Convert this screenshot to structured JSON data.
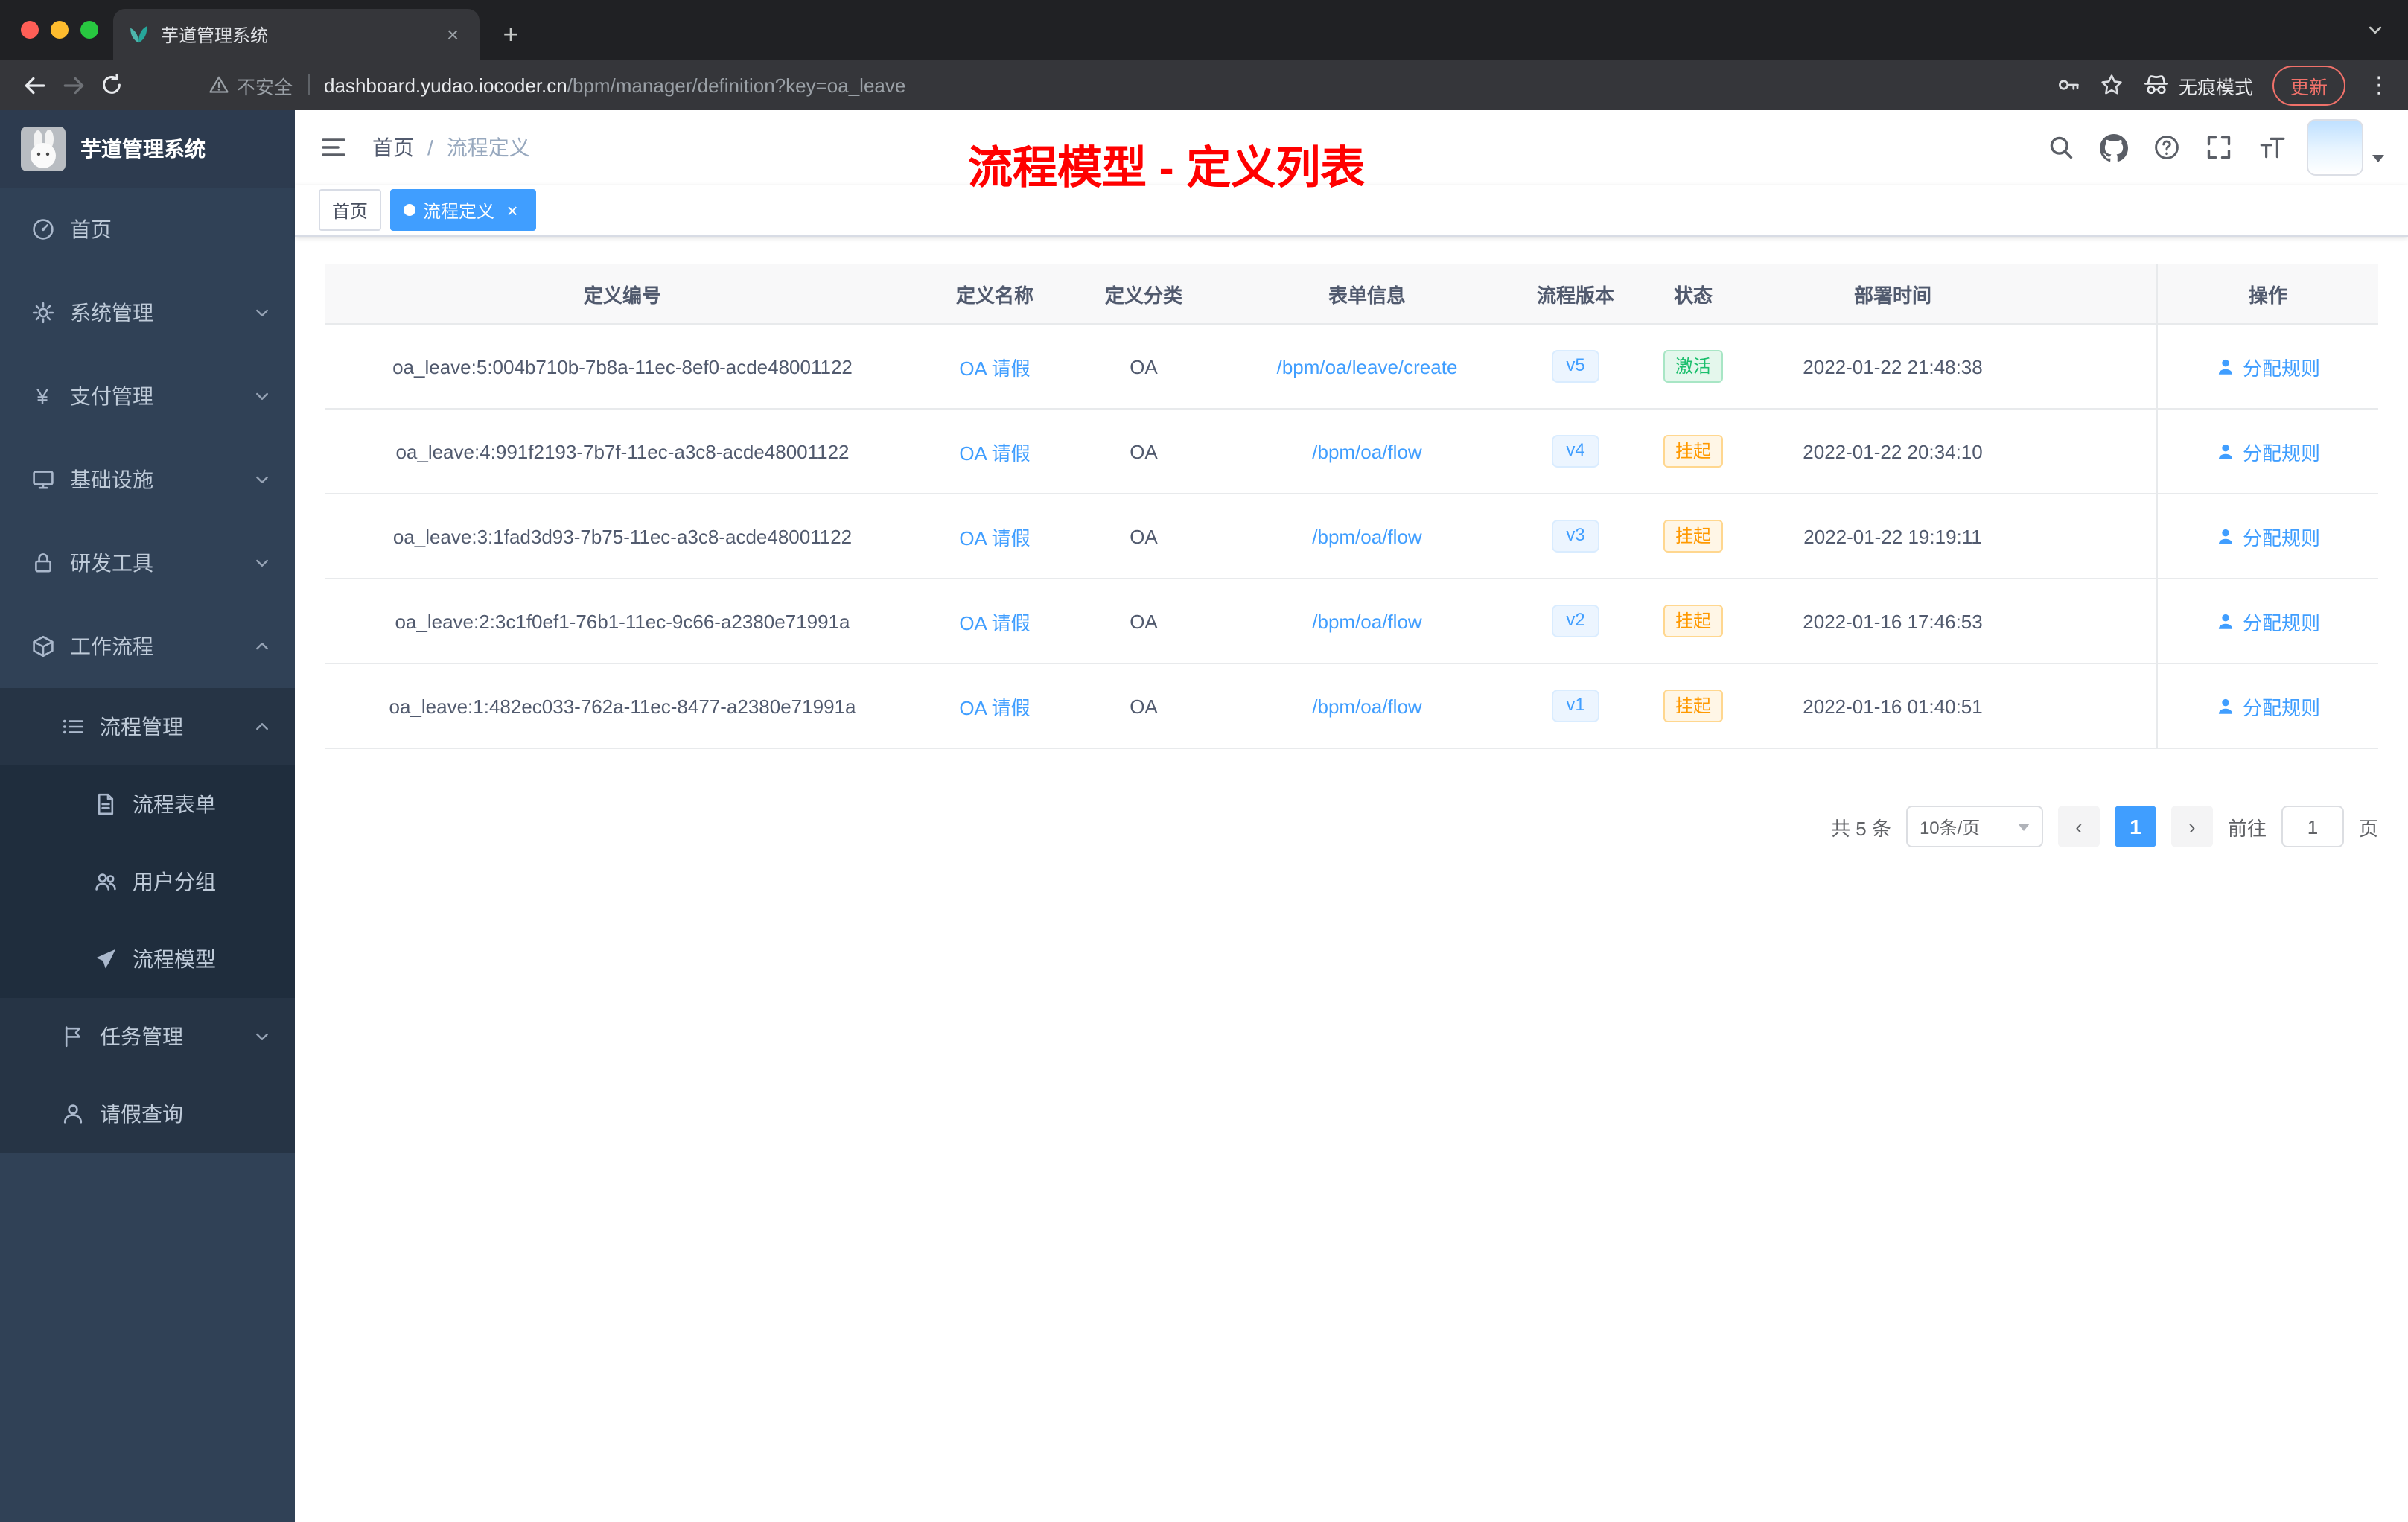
{
  "browser": {
    "tab_title": "芋道管理系统",
    "new_tab_glyph": "+",
    "tab_close_glyph": "×",
    "kebab_glyph": "⋮",
    "security_label": "不安全",
    "url_domain": "dashboard.yudao.iocoder.cn",
    "url_path": "/bpm/manager/definition?key=oa_leave",
    "incognito_label": "无痕模式",
    "update_label": "更新"
  },
  "sidebar": {
    "logo_title": "芋道管理系统",
    "items": [
      {
        "name": "home",
        "label": "首页",
        "icon": "dashboard-icon",
        "level": 1
      },
      {
        "name": "system-management",
        "label": "系统管理",
        "icon": "gear-icon",
        "level": 1,
        "chevron": "down"
      },
      {
        "name": "payment-management",
        "label": "支付管理",
        "icon": "yen-icon",
        "level": 1,
        "chevron": "down"
      },
      {
        "name": "infrastructure",
        "label": "基础设施",
        "icon": "monitor-icon",
        "level": 1,
        "chevron": "down"
      },
      {
        "name": "dev-tools",
        "label": "研发工具",
        "icon": "lock-icon",
        "level": 1,
        "chevron": "down"
      },
      {
        "name": "workflow",
        "label": "工作流程",
        "icon": "cube-icon",
        "level": 1,
        "chevron": "up"
      },
      {
        "name": "process-management",
        "label": "流程管理",
        "icon": "list-icon",
        "level": 2,
        "chevron": "up",
        "dark": true
      },
      {
        "name": "process-form",
        "label": "流程表单",
        "icon": "document-icon",
        "level": 3,
        "dark": true
      },
      {
        "name": "user-group",
        "label": "用户分组",
        "icon": "users-icon",
        "level": 3,
        "dark": true
      },
      {
        "name": "process-model",
        "label": "流程模型",
        "icon": "plane-icon",
        "level": 3,
        "dark": true
      },
      {
        "name": "task-management",
        "label": "任务管理",
        "icon": "flag-icon",
        "level": 2,
        "chevron": "down",
        "dark": true
      },
      {
        "name": "leave-query",
        "label": "请假查询",
        "icon": "user-icon",
        "level": 2,
        "dark": true
      }
    ]
  },
  "header": {
    "breadcrumb": {
      "home": "首页",
      "separator": "/",
      "current": "流程定义"
    },
    "annotation": "流程模型 - 定义列表"
  },
  "tags": [
    {
      "label": "首页",
      "active": false,
      "closable": false
    },
    {
      "label": "流程定义",
      "active": true,
      "closable": true
    }
  ],
  "table": {
    "columns": [
      "定义编号",
      "定义名称",
      "定义分类",
      "表单信息",
      "流程版本",
      "状态",
      "部署时间",
      "操作"
    ],
    "action_label": "分配规则",
    "rows": [
      {
        "id": "oa_leave:5:004b710b-7b8a-11ec-8ef0-acde48001122",
        "name": "OA 请假",
        "category": "OA",
        "form": "/bpm/oa/leave/create",
        "version": "v5",
        "status": "激活",
        "status_type": "success",
        "deploy_time": "2022-01-22 21:48:38"
      },
      {
        "id": "oa_leave:4:991f2193-7b7f-11ec-a3c8-acde48001122",
        "name": "OA 请假",
        "category": "OA",
        "form": "/bpm/oa/flow",
        "version": "v4",
        "status": "挂起",
        "status_type": "warning",
        "deploy_time": "2022-01-22 20:34:10"
      },
      {
        "id": "oa_leave:3:1fad3d93-7b75-11ec-a3c8-acde48001122",
        "name": "OA 请假",
        "category": "OA",
        "form": "/bpm/oa/flow",
        "version": "v3",
        "status": "挂起",
        "status_type": "warning",
        "deploy_time": "2022-01-22 19:19:11"
      },
      {
        "id": "oa_leave:2:3c1f0ef1-76b1-11ec-9c66-a2380e71991a",
        "name": "OA 请假",
        "category": "OA",
        "form": "/bpm/oa/flow",
        "version": "v2",
        "status": "挂起",
        "status_type": "warning",
        "deploy_time": "2022-01-16 17:46:53"
      },
      {
        "id": "oa_leave:1:482ec033-762a-11ec-8477-a2380e71991a",
        "name": "OA 请假",
        "category": "OA",
        "form": "/bpm/oa/flow",
        "version": "v1",
        "status": "挂起",
        "status_type": "warning",
        "deploy_time": "2022-01-16 01:40:51"
      }
    ]
  },
  "pagination": {
    "total": "共 5 条",
    "page_size": "10条/页",
    "prev": "‹",
    "next": "›",
    "current_page": "1",
    "goto_label": "前往",
    "goto_value": "1",
    "page_label": "页"
  },
  "colors": {
    "accent_blue": "#409eff",
    "success_green": "#19be6b",
    "warning_orange": "#ff9900",
    "annotation_red": "#ff0000",
    "sidebar_bg": "#304156",
    "sidebar_submenu_bg": "#263445"
  }
}
